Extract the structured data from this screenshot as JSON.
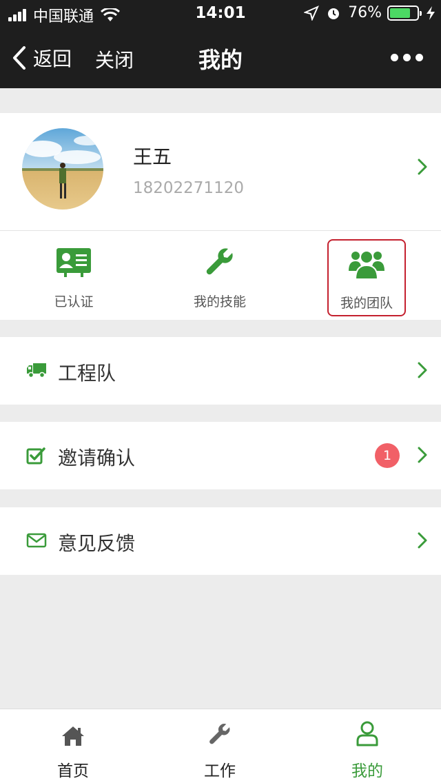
{
  "status_bar": {
    "carrier": "中国联通",
    "time": "14:01",
    "battery": "76%",
    "battery_level": 0.76
  },
  "navbar": {
    "back_label": "返回",
    "close_label": "关闭",
    "title": "我的"
  },
  "profile": {
    "name": "王五",
    "phone": "18202271120"
  },
  "shortcuts": [
    {
      "label": "已认证",
      "icon": "id-card-icon"
    },
    {
      "label": "我的技能",
      "icon": "wrench-icon"
    },
    {
      "label": "我的团队",
      "icon": "team-icon"
    }
  ],
  "menu": [
    {
      "label": "工程队",
      "icon": "truck-icon"
    },
    {
      "label": "邀请确认",
      "icon": "checkbox-icon",
      "badge": "1"
    },
    {
      "label": "意见反馈",
      "icon": "envelope-icon"
    }
  ],
  "tabs": [
    {
      "label": "首页",
      "icon": "home-icon"
    },
    {
      "label": "工作",
      "icon": "wrench-icon"
    },
    {
      "label": "我的",
      "icon": "user-icon",
      "active": true
    }
  ],
  "colors": {
    "accent_green": "#3a9b3a",
    "highlight_red": "#c4202e",
    "badge_red": "#f16067",
    "topbar": "#1e1e1e"
  }
}
